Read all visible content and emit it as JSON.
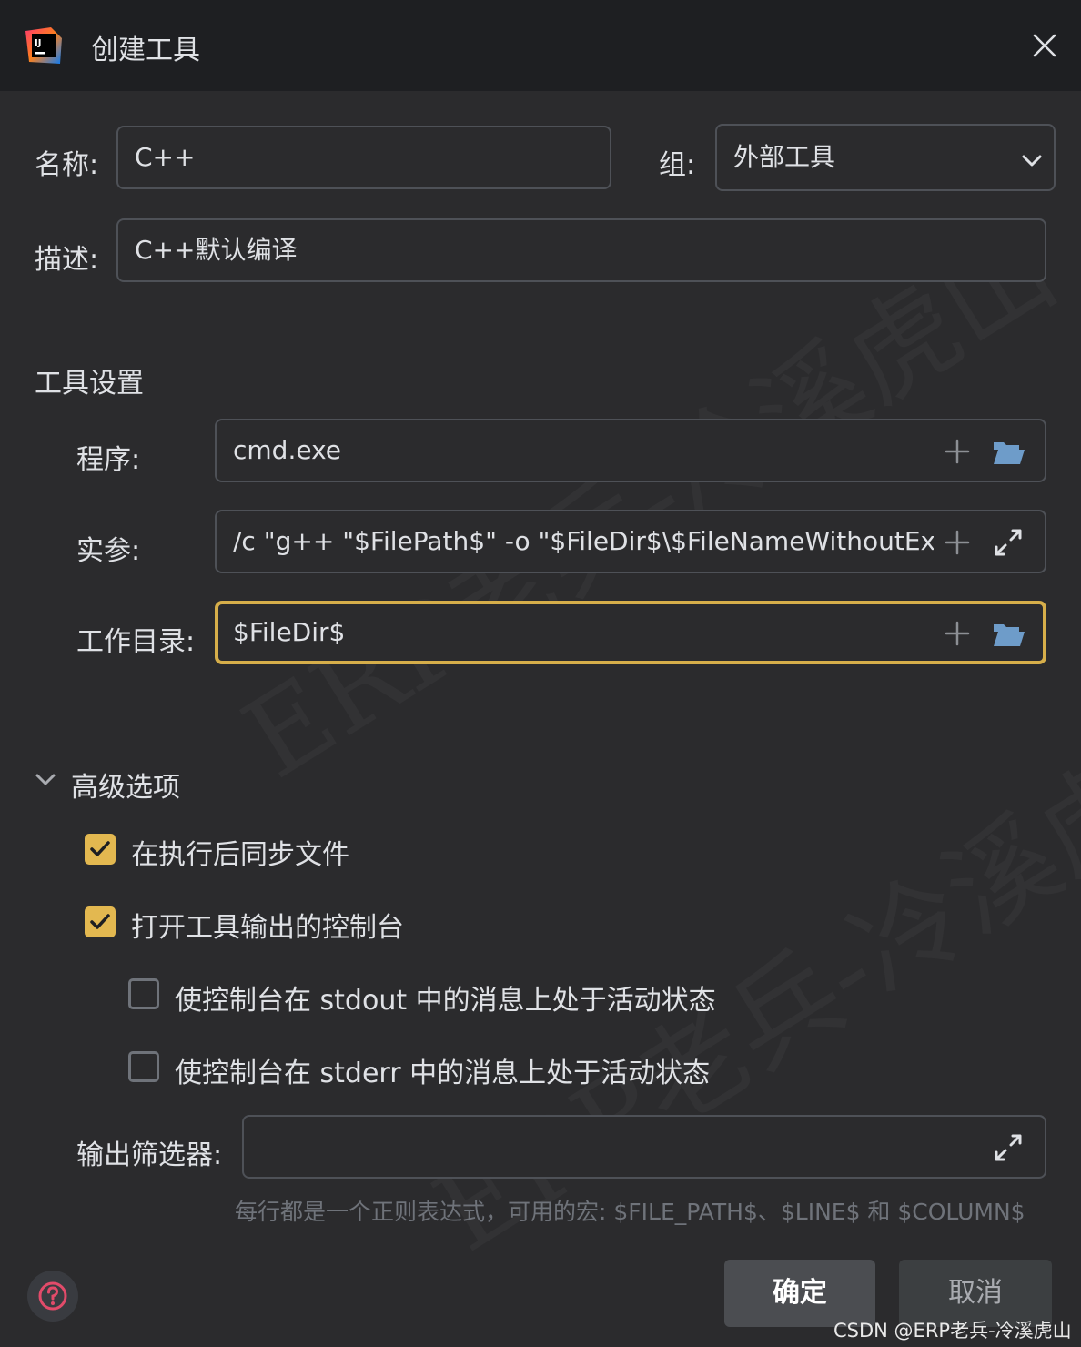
{
  "window": {
    "title": "创建工具"
  },
  "form": {
    "name_label": "名称:",
    "name_value": "C++",
    "group_label": "组:",
    "group_value": "外部工具",
    "desc_label": "描述:",
    "desc_value": "C++默认编译"
  },
  "tool_settings": {
    "heading": "工具设置",
    "program_label": "程序:",
    "program_value": "cmd.exe",
    "args_label": "实参:",
    "args_value": "/c \"g++ \"$FilePath$\" -o \"$FileDir$\\$FileNameWithoutExte",
    "workdir_label": "工作目录:",
    "workdir_value": "$FileDir$"
  },
  "advanced": {
    "heading": "高级选项",
    "options": [
      {
        "label": "在执行后同步文件",
        "checked": true
      },
      {
        "label": "打开工具输出的控制台",
        "checked": true
      },
      {
        "label": "使控制台在 stdout 中的消息上处于活动状态",
        "checked": false
      },
      {
        "label": "使控制台在 stderr 中的消息上处于活动状态",
        "checked": false
      }
    ],
    "output_filter_label": "输出筛选器:",
    "output_filter_value": "",
    "hint": "每行都是一个正则表达式，可用的宏: $FILE_PATH$、$LINE$ 和 $COLUMN$"
  },
  "buttons": {
    "ok": "确定",
    "cancel": "取消"
  },
  "watermark": "ERP老兵-冷溪虎山",
  "credit": "CSDN @ERP老兵-冷溪虎山",
  "colors": {
    "background": "#2b2b2d",
    "titlebar": "#1e1f22",
    "accent_focus": "#d6ae4a",
    "checkbox_checked": "#e3b850",
    "icon_blue": "#6e9cc9"
  }
}
